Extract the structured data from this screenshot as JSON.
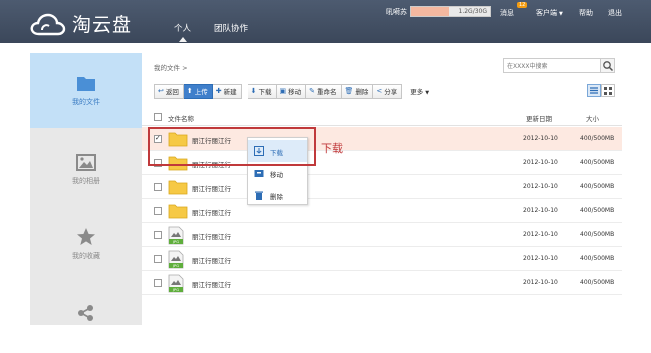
{
  "header": {
    "logo_text": "淘云盘",
    "tabs": [
      {
        "label": "个人",
        "active": true
      },
      {
        "label": "团队协作",
        "active": false
      }
    ],
    "username": "吼嗬苏",
    "quota_text": "1.2G/30G",
    "quota_fraction": 0.48,
    "links": {
      "messages": "消息",
      "message_count": "12",
      "client": "客户端",
      "help": "帮助",
      "logout": "退出"
    }
  },
  "sidebar": {
    "items": [
      {
        "label": "我的文件",
        "icon": "folder-icon",
        "active": true
      },
      {
        "label": "我的相册",
        "icon": "photo-icon",
        "active": false
      },
      {
        "label": "我的收藏",
        "icon": "star-icon",
        "active": false
      },
      {
        "label": "",
        "icon": "share-icon",
        "active": false
      }
    ]
  },
  "main": {
    "breadcrumb": "我的文件 >",
    "search_placeholder": "在XXXX中搜索",
    "toolbar": {
      "back": "返回",
      "upload": "上传",
      "new": "新建",
      "download": "下载",
      "move": "移动",
      "rename": "重命名",
      "delete": "删除",
      "share": "分享",
      "more": "更多"
    },
    "columns": {
      "name": "文件名称",
      "date": "更新日期",
      "size": "大小"
    },
    "files": [
      {
        "name": "丽江行丽江行",
        "type": "folder",
        "date": "2012-10-10",
        "size": "400/500MB",
        "selected": true
      },
      {
        "name": "丽江行丽江行",
        "type": "folder",
        "date": "2012-10-10",
        "size": "400/500MB",
        "selected": false
      },
      {
        "name": "丽江行丽江行",
        "type": "folder",
        "date": "2012-10-10",
        "size": "400/500MB",
        "selected": false
      },
      {
        "name": "丽江行丽江行",
        "type": "folder",
        "date": "2012-10-10",
        "size": "400/500MB",
        "selected": false
      },
      {
        "name": "丽江行丽江行",
        "type": "jpg",
        "date": "2012-10-10",
        "size": "400/500MB",
        "selected": false
      },
      {
        "name": "丽江行丽江行",
        "type": "jpg",
        "date": "2012-10-10",
        "size": "400/500MB",
        "selected": false
      },
      {
        "name": "丽江行丽江行",
        "type": "jpg",
        "date": "2012-10-10",
        "size": "400/500MB",
        "selected": false
      }
    ],
    "context_menu": {
      "download": "下载",
      "move": "移动",
      "delete": "删除"
    },
    "annotation": "下载"
  },
  "colors": {
    "header": "#3b475a",
    "accent": "#3f7fcb",
    "sidebar_active": "#c3e0f7",
    "selected_row": "#fde9e1",
    "annotation": "#c0393b"
  }
}
